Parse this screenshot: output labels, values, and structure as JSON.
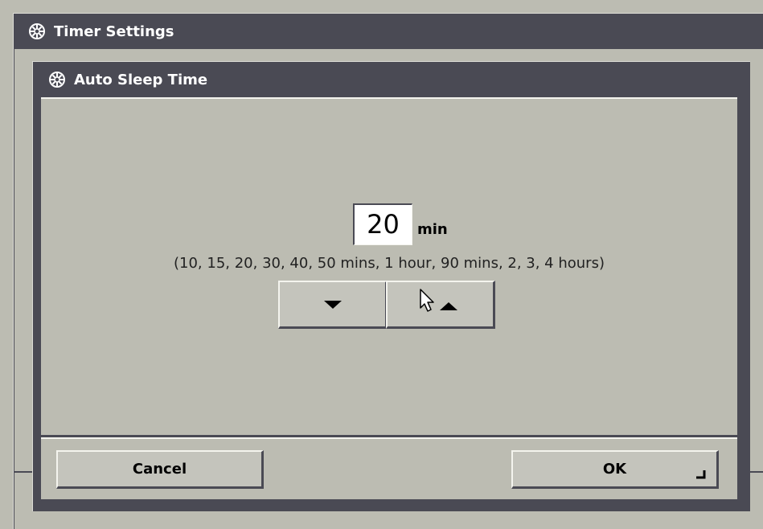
{
  "window": {
    "title": "Timer Settings",
    "icon": "settings-wheel-icon"
  },
  "dialog": {
    "title": "Auto Sleep Time",
    "icon": "settings-wheel-icon",
    "value": "20",
    "unit": "min",
    "hint": "(10, 15, 20, 30, 40, 50 mins, 1 hour, 90 mins, 2, 3, 4 hours)"
  },
  "stepper": {
    "down_icon": "arrow-down-icon",
    "up_icon": "arrow-up-icon"
  },
  "footer": {
    "cancel_label": "Cancel",
    "ok_label": "OK",
    "ok_icon": "enter-return-icon"
  },
  "colors": {
    "frame": "#4a4a54",
    "panel": "#bcbcb2",
    "button": "#c4c4bc",
    "highlight": "#f4f4ee",
    "title_text": "#ffffff"
  }
}
